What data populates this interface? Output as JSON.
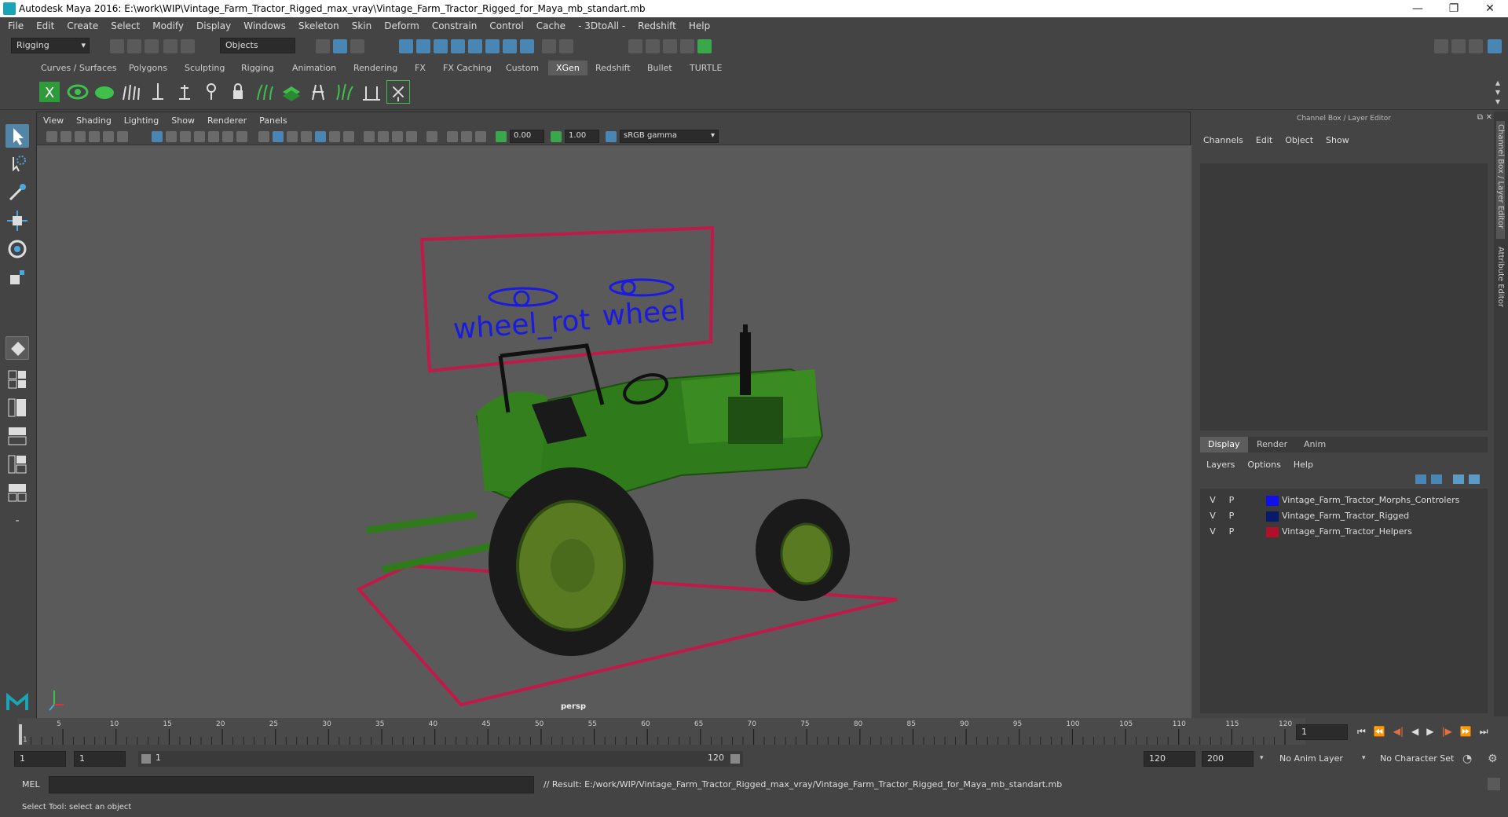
{
  "titlebar": {
    "title": "Autodesk Maya 2016: E:\\work\\WIP\\Vintage_Farm_Tractor_Rigged_max_vray\\Vintage_Farm_Tractor_Rigged_for_Maya_mb_standart.mb",
    "minimize": "—",
    "restore": "❐",
    "close": "✕"
  },
  "menubar": [
    "File",
    "Edit",
    "Create",
    "Select",
    "Modify",
    "Display",
    "Windows",
    "Skeleton",
    "Skin",
    "Deform",
    "Constrain",
    "Control",
    "Cache",
    "- 3DtoAll -",
    "Redshift",
    "Help"
  ],
  "statusline": {
    "mode": "Rigging",
    "selection_mask": "Objects"
  },
  "shelf_tabs": [
    "Curves / Surfaces",
    "Polygons",
    "Sculpting",
    "Rigging",
    "Animation",
    "Rendering",
    "FX",
    "FX Caching",
    "Custom",
    "XGen",
    "Redshift",
    "Bullet",
    "TURTLE"
  ],
  "shelf_active_tab": "XGen",
  "viewport": {
    "menu": [
      "View",
      "Shading",
      "Lighting",
      "Show",
      "Renderer",
      "Panels"
    ],
    "exposure": "0.00",
    "gamma": "1.00",
    "color_space": "sRGB gamma",
    "camera_label": "persp",
    "labels": {
      "left": "wheel_rot",
      "right": "wheel"
    }
  },
  "channel_box": {
    "title": "Channel Box / Layer Editor",
    "menu": [
      "Channels",
      "Edit",
      "Object",
      "Show"
    ],
    "layer_tabs": [
      "Display",
      "Render",
      "Anim"
    ],
    "layer_tab_active": "Display",
    "layer_menu": [
      "Layers",
      "Options",
      "Help"
    ],
    "layers": [
      {
        "v": "V",
        "p": "P",
        "color": "#1010e8",
        "name": "Vintage_Farm_Tractor_Morphs_Controlers"
      },
      {
        "v": "V",
        "p": "P",
        "color": "#0a1a6a",
        "name": "Vintage_Farm_Tractor_Rigged"
      },
      {
        "v": "V",
        "p": "P",
        "color": "#b0102a",
        "name": "Vintage_Farm_Tractor_Helpers"
      }
    ]
  },
  "side_tabs": [
    "Channel Box / Layer Editor",
    "Attribute Editor"
  ],
  "timeline": {
    "ticks": [
      "1",
      "5",
      "10",
      "15",
      "20",
      "25",
      "30",
      "35",
      "40",
      "45",
      "50",
      "55",
      "60",
      "65",
      "70",
      "75",
      "80",
      "85",
      "90",
      "95",
      "100",
      "105",
      "110",
      "115",
      "120"
    ],
    "current_frame": "1"
  },
  "range": {
    "start": "1",
    "playback_start": "1",
    "slider_start": "1",
    "slider_end": "120",
    "playback_end": "120",
    "end": "200",
    "anim_layer": "No Anim Layer",
    "character_set": "No Character Set"
  },
  "cmdline": {
    "label": "MEL",
    "result": "// Result: E:/work/WIP/Vintage_Farm_Tractor_Rigged_max_vray/Vintage_Farm_Tractor_Rigged_for_Maya_mb_standart.mb"
  },
  "helpline": "Select Tool: select an object",
  "colors": {
    "accent": "#5285a6",
    "helper": "#c0194a",
    "controller": "#1a1ae0",
    "tractor": "#2f7a1a"
  }
}
